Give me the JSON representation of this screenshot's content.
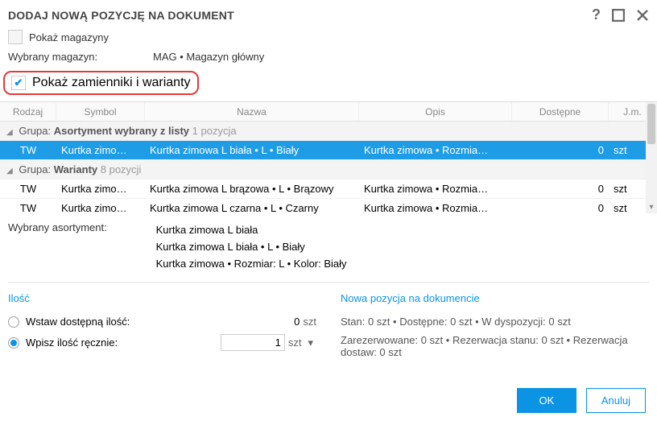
{
  "title": "DODAJ NOWĄ POZYCJĘ NA DOKUMENT",
  "showWarehouses": {
    "label": "Pokaż magazyny",
    "checked": false
  },
  "selectedWarehouse": {
    "label": "Wybrany magazyn:",
    "value": "MAG • Magazyn główny"
  },
  "showVariants": {
    "label": "Pokaż zamienniki i warianty",
    "checked": true
  },
  "columns": {
    "rodzaj": "Rodzaj",
    "symbol": "Symbol",
    "nazwa": "Nazwa",
    "opis": "Opis",
    "dostepne": "Dostępne",
    "jm": "J.m."
  },
  "group1": {
    "prefix": "Grupa:",
    "name": "Asortyment wybrany z listy",
    "count": "1 pozycja"
  },
  "group2": {
    "prefix": "Grupa:",
    "name": "Warianty",
    "count": "8 pozycji"
  },
  "rows": [
    {
      "rodzaj": "TW",
      "symbol": "Kurtka zimo…",
      "nazwa": "Kurtka zimowa L biała • L • Biały",
      "opis": "Kurtka zimowa • Rozmia…",
      "dost": "0",
      "jm": "szt"
    },
    {
      "rodzaj": "TW",
      "symbol": "Kurtka zimo…",
      "nazwa": "Kurtka zimowa L brązowa • L • Brązowy",
      "opis": "Kurtka zimowa • Rozmia…",
      "dost": "0",
      "jm": "szt"
    },
    {
      "rodzaj": "TW",
      "symbol": "Kurtka zimo…",
      "nazwa": "Kurtka zimowa L czarna • L • Czarny",
      "opis": "Kurtka zimowa • Rozmia…",
      "dost": "0",
      "jm": "szt"
    }
  ],
  "selectedItem": {
    "label": "Wybrany asortyment:",
    "line1": "Kurtka zimowa L biała",
    "line2": "Kurtka zimowa L biała • L • Biały",
    "line3": "Kurtka zimowa • Rozmiar: L • Kolor: Biały"
  },
  "qtySection": {
    "title": "Ilość",
    "opt1": {
      "label": "Wstaw dostępną ilość:",
      "value": "0",
      "unit": "szt",
      "on": false
    },
    "opt2": {
      "label": "Wpisz ilość ręcznie:",
      "value": "1",
      "unit": "szt",
      "on": true
    }
  },
  "docSection": {
    "title": "Nowa pozycja na dokumencie",
    "line1": "Stan: 0 szt  •  Dostępne: 0 szt  •  W dyspozycji: 0 szt",
    "line2": "Zarezerwowane: 0 szt  •  Rezerwacja stanu: 0 szt  •  Rezerwacja dostaw: 0 szt"
  },
  "buttons": {
    "ok": "OK",
    "cancel": "Anuluj"
  }
}
